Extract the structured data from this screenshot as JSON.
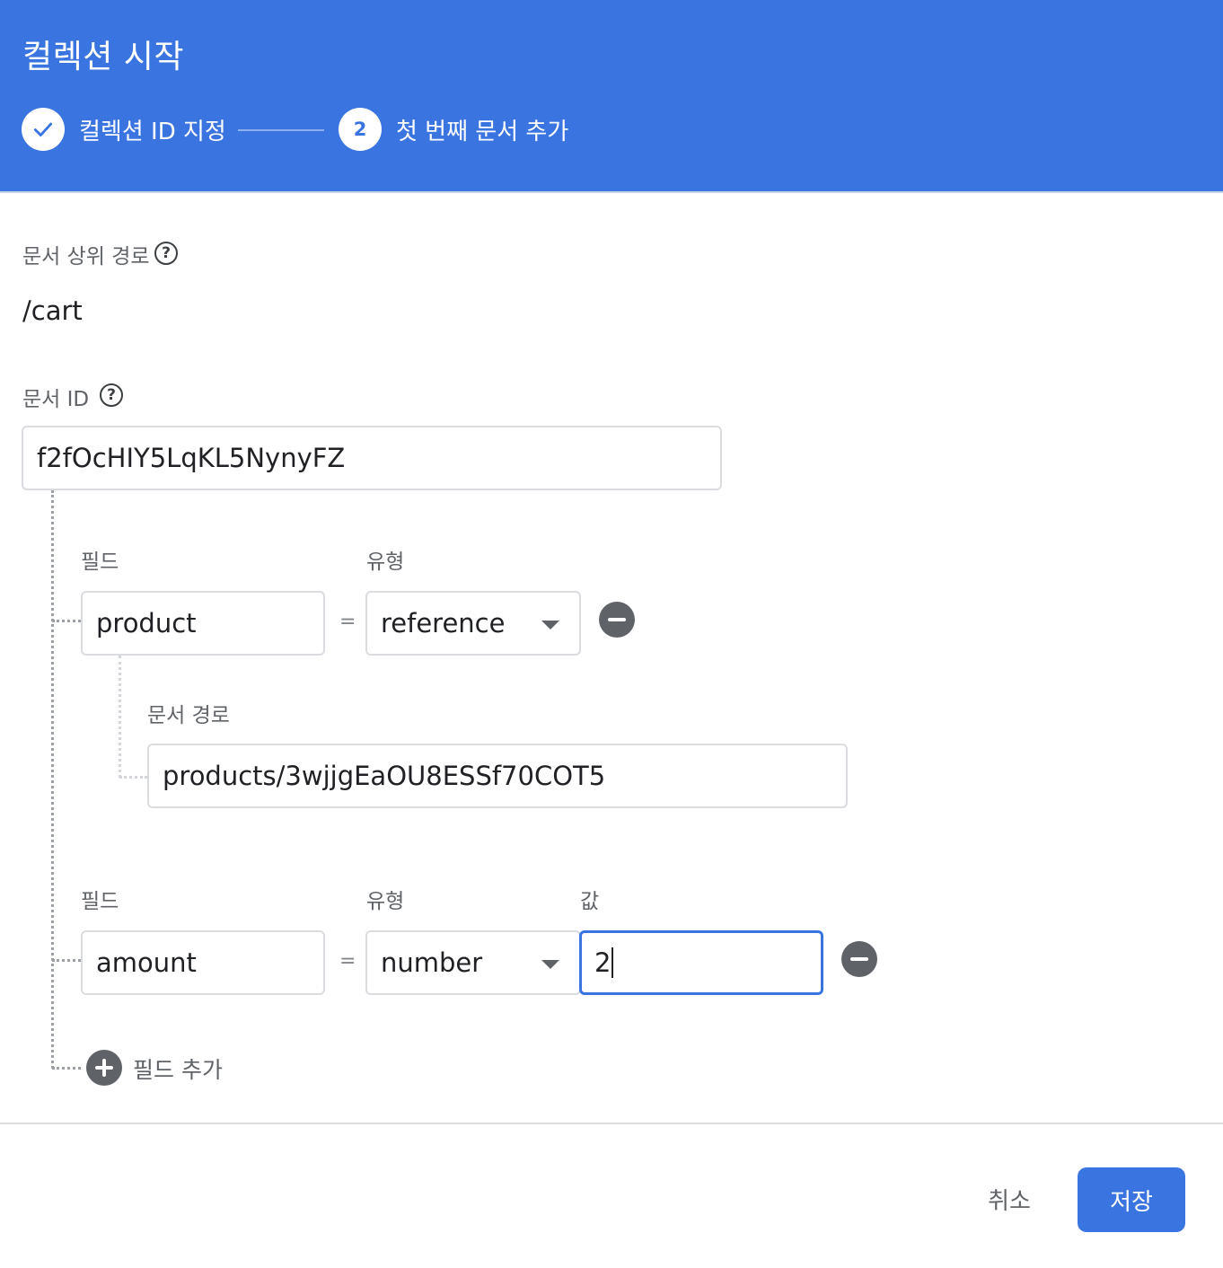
{
  "dialog": {
    "title": "컬렉션 시작",
    "steps": [
      {
        "label": "컬렉션 ID 지정",
        "status": "done",
        "icon": "check-icon"
      },
      {
        "number": "2",
        "label": "첫 번째 문서 추가",
        "status": "active"
      }
    ]
  },
  "parent_path": {
    "label": "문서 상위 경로",
    "value": "/cart",
    "help_icon": "help-icon"
  },
  "document_id": {
    "label": "문서 ID",
    "value": "f2fOcHIY5LqKL5NynyFZ",
    "help_icon": "help-icon"
  },
  "fields": [
    {
      "field_label": "필드",
      "type_label": "유형",
      "name": "product",
      "equals": "=",
      "type": "reference",
      "ref_path_label": "문서 경로",
      "ref_path": "products/3wjjgEaOU8ESSf70COT5"
    },
    {
      "field_label": "필드",
      "type_label": "유형",
      "value_label": "값",
      "name": "amount",
      "equals": "=",
      "type": "number",
      "value": "2"
    }
  ],
  "add_field": {
    "label": "필드 추가"
  },
  "footer": {
    "cancel_label": "취소",
    "save_label": "저장"
  },
  "colors": {
    "header": "#3a74e0",
    "primary_button": "#3a74e0",
    "focus_border": "#3a74e0"
  }
}
